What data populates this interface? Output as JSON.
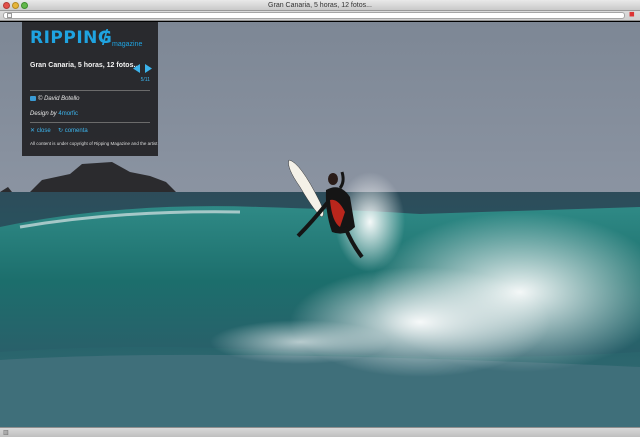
{
  "window": {
    "title": "Gran Canaria, 5 horas, 12 fotos..."
  },
  "panel": {
    "logo_main": "RIPPING",
    "logo_sub": "magazine",
    "gallery_title": "Gran Canaria, 5 horas, 12 fotos...",
    "counter": "5/11",
    "credit": "© David Botello",
    "design_prefix": "Design by",
    "design_link": "4morfic",
    "close_label": "✕ close",
    "comments_label": "↻ comenta",
    "copyright": "All content is under copyright of Ripping Magazine and the artist"
  },
  "icons": {
    "camera": "camera-icon",
    "prev": "arrow-left-icon",
    "next": "arrow-right-icon"
  },
  "colors": {
    "accent": "#1fa3e0",
    "panel_bg": "#222226"
  }
}
